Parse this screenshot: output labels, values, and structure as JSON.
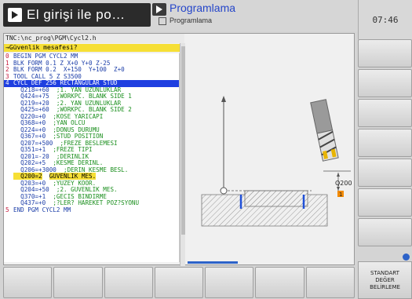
{
  "header": {
    "mode_tab": "El girişi ile po…",
    "prog_title": "Programlama",
    "prog_sub": "Programlama",
    "clock": "07:46"
  },
  "editor": {
    "path": "TNC:\\nc_prog\\PGM\\Cycl2.h",
    "hint": "→Güvenlik mesafesi?",
    "lines": [
      {
        "n": "0",
        "text": "BEGIN PGM CYCL2 MM",
        "comment": ""
      },
      {
        "n": "1",
        "text": "BLK FORM 0.1 Z X+0 Y+0 Z-25",
        "comment": ""
      },
      {
        "n": "2",
        "text": "BLK FORM 0.2  X+150  Y+100  Z+0",
        "comment": ""
      },
      {
        "n": "3",
        "text": "TOOL CALL 5 Z S3500",
        "comment": ""
      },
      {
        "n": "4",
        "text": "CYCL DEF 256 RECTANGULAR STUD",
        "comment": ""
      },
      {
        "n": "",
        "text": "  Q218=+60",
        "comment": ";1. YAN UZUNLUKLAR"
      },
      {
        "n": "",
        "text": "  Q424=+75",
        "comment": ";WORKPC. BLANK SIDE 1"
      },
      {
        "n": "",
        "text": "  Q219=+20",
        "comment": ";2. YAN UZUNLUKLAR"
      },
      {
        "n": "",
        "text": "  Q425=+60",
        "comment": ";WORKPC. BLANK SIDE 2"
      },
      {
        "n": "",
        "text": "  Q220=+0",
        "comment": ";KOSE YARICAPI"
      },
      {
        "n": "",
        "text": "  Q368=+0",
        "comment": ";YAN OLCU"
      },
      {
        "n": "",
        "text": "  Q224=+0",
        "comment": ";DONUS DURUMU"
      },
      {
        "n": "",
        "text": "  Q367=+0",
        "comment": ";STUD POSITION"
      },
      {
        "n": "",
        "text": "  Q207=+500",
        "comment": ";FREZE BESLEMESI"
      },
      {
        "n": "",
        "text": "  Q351=+1",
        "comment": ";FREZE TIPI"
      },
      {
        "n": "",
        "text": "  Q201=-20",
        "comment": ";DERINLIK"
      },
      {
        "n": "",
        "text": "  Q202=+5",
        "comment": ";KESME DERINL."
      },
      {
        "n": "",
        "text": "  Q206=+3000",
        "comment": ";DERIN KESME BESL."
      },
      {
        "n": "",
        "text": "  Q200=2",
        "comment": "GUVENLIK MES."
      },
      {
        "n": "",
        "text": "  Q203=+0",
        "comment": ";YUZEY KOOR."
      },
      {
        "n": "",
        "text": "  Q204=+50",
        "comment": ";2. GUVENLIK MES."
      },
      {
        "n": "",
        "text": "  Q370=+1",
        "comment": ";GECIS BINDIRME"
      },
      {
        "n": "",
        "text": "  Q437=+0",
        "comment": ";?LER? HAREKET POZ?SYONU"
      },
      {
        "n": "5",
        "text": "END PGM CYCL2 MM",
        "comment": ""
      }
    ]
  },
  "drawing": {
    "label_q200": "Q200",
    "label_badge": "1"
  },
  "softkeys": {
    "standard_line1": "STANDART",
    "standard_line2": "DEĞER",
    "standard_line3": "BELİRLEME"
  },
  "colors": {
    "selection": "#1f3fe0",
    "highlight": "#f6df35",
    "line_number": "#c6183b",
    "comment": "#1b8f1e",
    "keyword": "#1b3da8"
  }
}
